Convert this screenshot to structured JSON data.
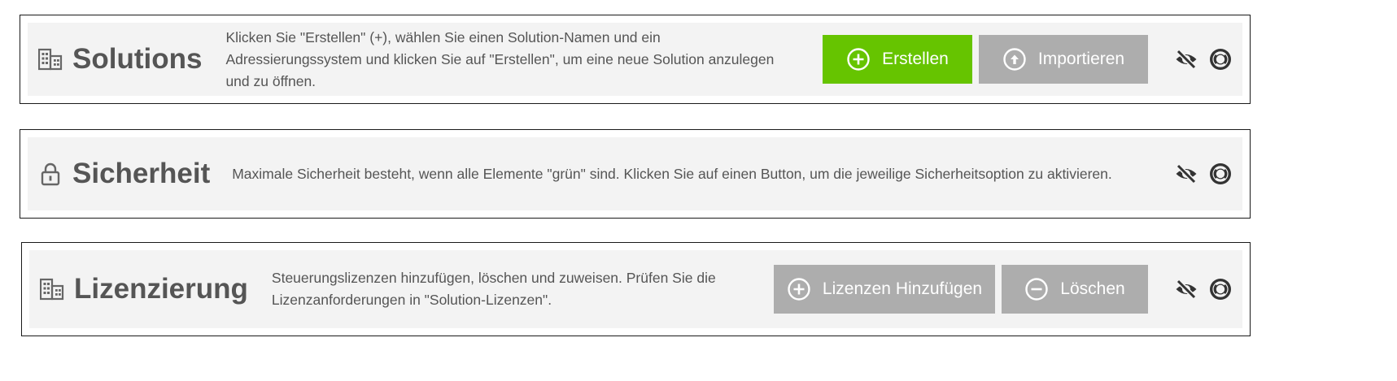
{
  "solutions": {
    "title": "Solutions",
    "title_icon": "building-icon",
    "description": "Klicken Sie \"Erstellen\" (+), wählen Sie einen Solution-Namen und ein Adressierungssystem und klicken Sie auf \"Erstellen\", um eine neue Solution anzulegen und zu öffnen.",
    "buttons": [
      {
        "label": "Erstellen",
        "icon": "plus-circle-icon",
        "color": "#66c400"
      },
      {
        "label": "Importieren",
        "icon": "upload-circle-icon",
        "color": "#adadad"
      }
    ],
    "actions": [
      "eye-off-icon",
      "help-lifebuoy-icon"
    ]
  },
  "sicherheit": {
    "title": "Sicherheit",
    "title_icon": "lock-icon",
    "description": "Maximale Sicherheit besteht, wenn alle Elemente \"grün\" sind. Klicken Sie auf einen Button, um die jeweilige Sicherheitsoption zu aktivieren.",
    "actions": [
      "eye-off-icon",
      "help-lifebuoy-icon"
    ]
  },
  "lizenzierung": {
    "title": "Lizenzierung",
    "title_icon": "building-icon",
    "description": "Steuerungslizenzen hinzufügen, löschen und zuweisen. Prüfen Sie die Lizenzanforderungen in \"Solution-Lizenzen\".",
    "buttons": [
      {
        "label": "Lizenzen Hinzufügen",
        "icon": "plus-circle-icon",
        "color": "#adadad"
      },
      {
        "label": "Löschen",
        "icon": "minus-circle-icon",
        "color": "#adadad"
      }
    ],
    "actions": [
      "eye-off-icon",
      "help-lifebuoy-icon"
    ]
  },
  "colors": {
    "accent_green": "#66c400",
    "button_gray": "#adadad",
    "panel_bg": "#f3f3f3",
    "text": "#555555",
    "icon_dark": "#333333"
  }
}
